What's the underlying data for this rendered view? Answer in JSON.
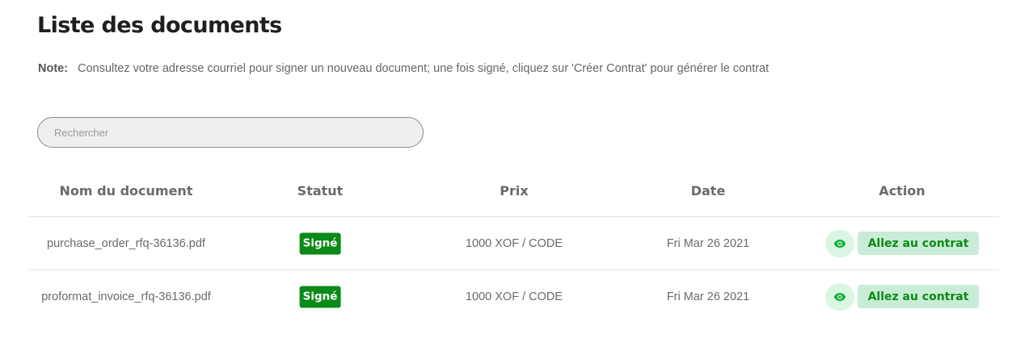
{
  "page": {
    "title": "Liste des documents",
    "note_label": "Note:",
    "note_text": "Consultez votre adresse courriel pour signer un nouveau document; une fois signé, cliquez sur 'Créer Contrat' pour générer le contrat"
  },
  "search": {
    "placeholder": "Rechercher",
    "value": ""
  },
  "table": {
    "headers": [
      "Nom du document",
      "Statut",
      "Prix",
      "Date",
      "Action"
    ],
    "rows": [
      {
        "name": "purchase_order_rfq-36136.pdf",
        "status": "Signé",
        "price": "1000 XOF / CODE",
        "date": "Fri Mar 26 2021",
        "action_label": "Allez au contrat",
        "view_icon": "eye-icon"
      },
      {
        "name": "proformat_invoice_rfq-36136.pdf",
        "status": "Signé",
        "price": "1000 XOF / CODE",
        "date": "Fri Mar 26 2021",
        "action_label": "Allez au contrat",
        "view_icon": "eye-icon"
      }
    ]
  },
  "colors": {
    "status_signed": "#0a8a16",
    "action_button_bg": "#c9ecd6",
    "action_text": "#0c8a14",
    "eye_button_bg": "#d9f6e3",
    "eye_icon": "#12b03a"
  }
}
